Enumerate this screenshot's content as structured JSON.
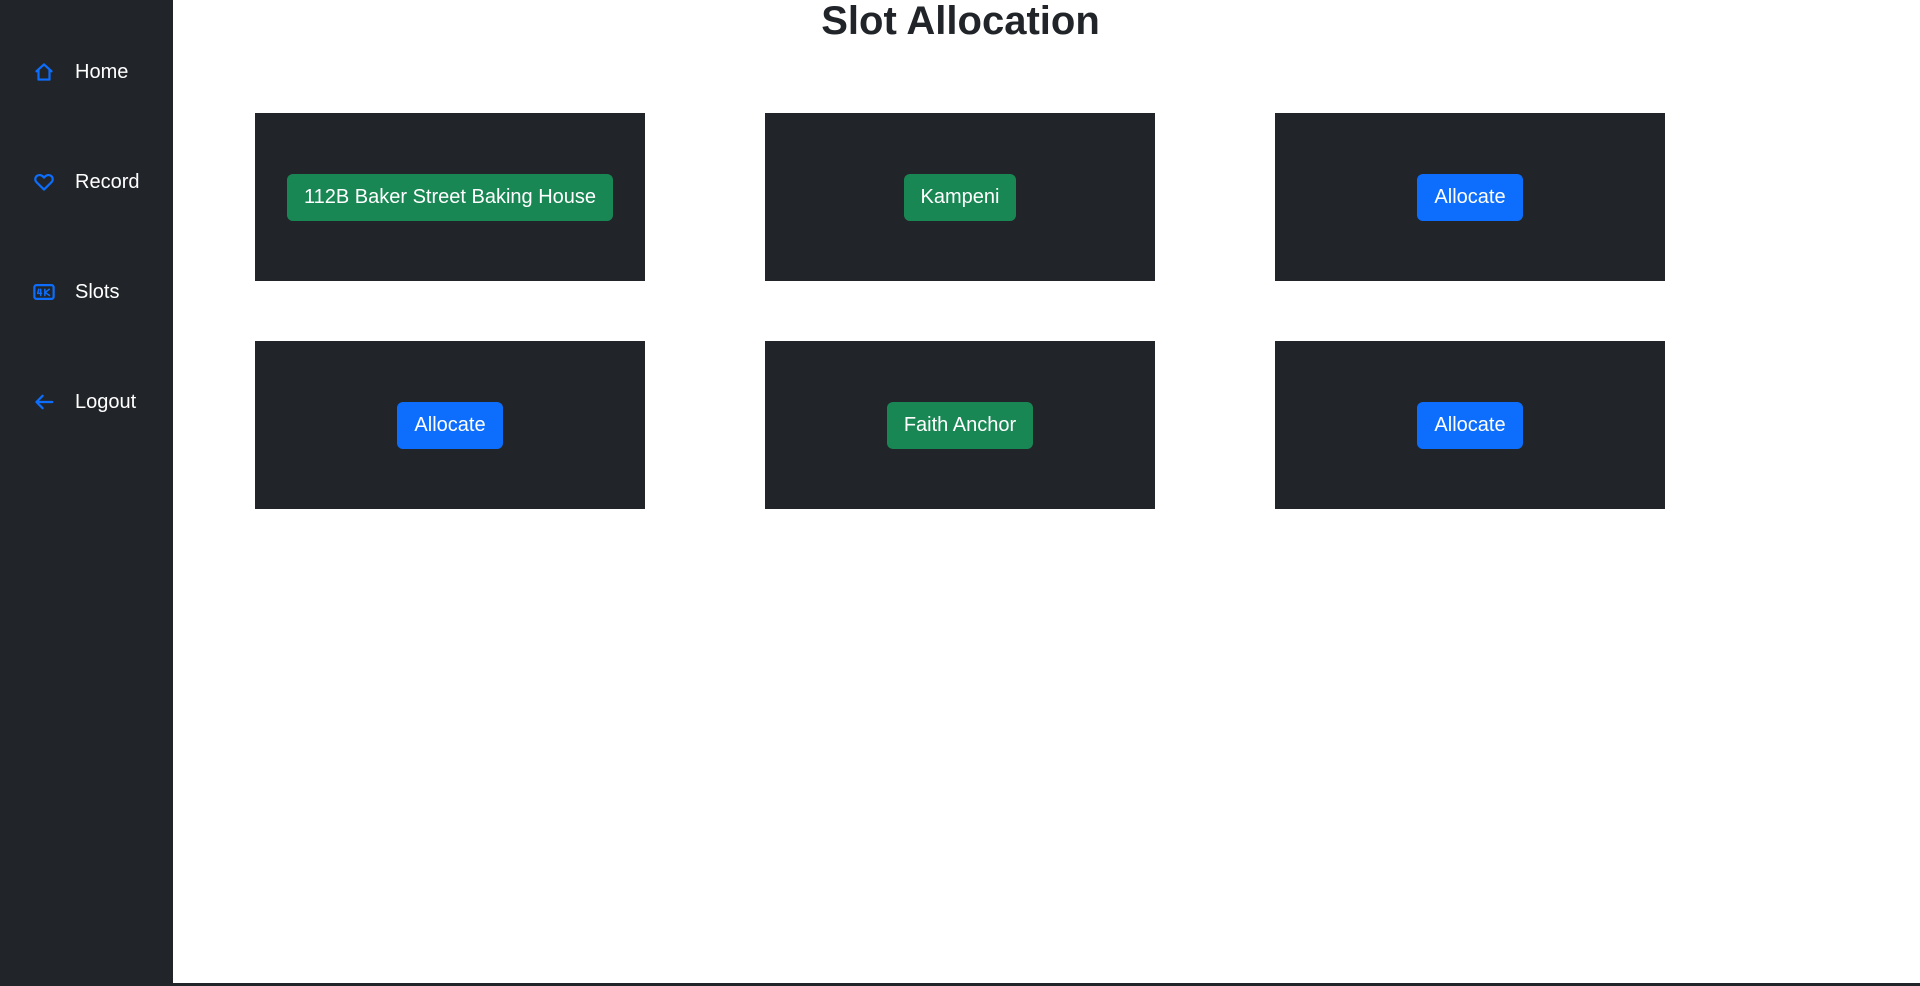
{
  "sidebar": {
    "items": [
      {
        "label": "Home",
        "icon": "house-icon"
      },
      {
        "label": "Record",
        "icon": "heart-icon"
      },
      {
        "label": "Slots",
        "icon": "4k-icon"
      },
      {
        "label": "Logout",
        "icon": "arrow-left-icon"
      }
    ]
  },
  "main": {
    "title": "Slot Allocation",
    "slots": [
      {
        "label": "112B Baker Street Baking House",
        "status": "occupied"
      },
      {
        "label": "Kampeni",
        "status": "occupied"
      },
      {
        "label": "Allocate",
        "status": "free"
      },
      {
        "label": "Allocate",
        "status": "free"
      },
      {
        "label": "Faith Anchor",
        "status": "occupied"
      },
      {
        "label": "Allocate",
        "status": "free"
      }
    ]
  },
  "colors": {
    "sidebar_bg": "#212529",
    "icon_accent": "#0d6efd",
    "occupied_button": "#198754",
    "allocate_button": "#0d6efd",
    "card_bg": "#212529"
  }
}
